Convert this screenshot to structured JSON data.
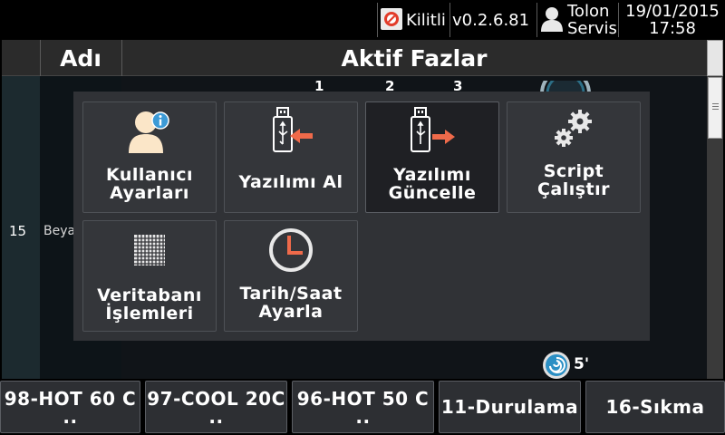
{
  "statusbar": {
    "lock_label": "Kilitli",
    "version": "v0.2.6.81",
    "user_line1": "Tolon",
    "user_line2": "Servis",
    "date": "19/01/2015",
    "time": "17:58"
  },
  "table": {
    "headers": {
      "name": "Adı",
      "phases": "Aktif Fazlar"
    },
    "phase_numbers": [
      "1",
      "2",
      "3"
    ],
    "row": {
      "number": "15",
      "name": "Beya"
    },
    "remaining_time": "5'"
  },
  "menu": {
    "items": [
      {
        "line1": "Kullanıcı",
        "line2": "Ayarları",
        "icon": "user-info-icon"
      },
      {
        "line1": "Yazılımı Al",
        "line2": "",
        "icon": "usb-import-icon"
      },
      {
        "line1": "Yazılımı",
        "line2": "Güncelle",
        "icon": "usb-export-icon",
        "selected": true
      },
      {
        "line1": "Script",
        "line2": "Çalıştır",
        "icon": "gears-icon"
      },
      {
        "line1": "Veritabanı",
        "line2": "İşlemleri",
        "icon": "database-grid-icon"
      },
      {
        "line1": "Tarih/Saat",
        "line2": "Ayarla",
        "icon": "clock-icon"
      }
    ],
    "accent_color": "#ef6a4a"
  },
  "programs": [
    {
      "line1": "98-HOT 60 C",
      "line2": ".."
    },
    {
      "line1": "97-COOL 20C",
      "line2": ".."
    },
    {
      "line1": "96-HOT 50 C",
      "line2": ".."
    },
    {
      "line1": "11-Durulama",
      "line2": ""
    },
    {
      "line1": "16-Sıkma",
      "line2": ""
    }
  ]
}
